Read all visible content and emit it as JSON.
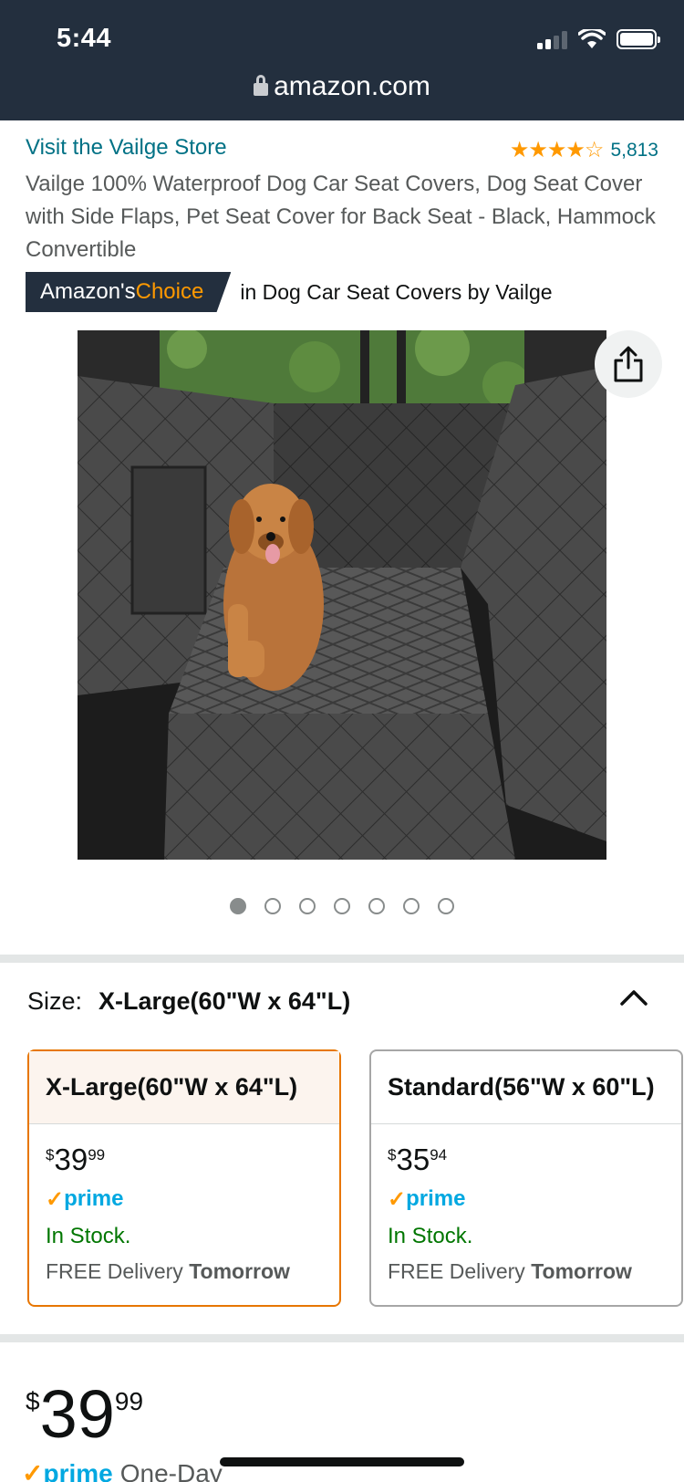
{
  "status_bar": {
    "time": "5:44"
  },
  "url_bar": {
    "domain": "amazon.com"
  },
  "product": {
    "store_link": "Visit the Vailge Store",
    "stars": "★★★★☆",
    "rating_count": "5,813",
    "title": "Vailge 100% Waterproof Dog Car Seat Covers, Dog Seat Cover with Side Flaps, Pet Seat Cover for Back Seat - Black, Hammock Convertible",
    "badge_prefix": "Amazon's",
    "badge_choice": "Choice",
    "badge_category": "in Dog Car Seat Covers by Vailge",
    "image_count": 7,
    "active_image": 1
  },
  "size": {
    "label": "Size:",
    "selected": "X-Large(60\"W x 64\"L)"
  },
  "options": [
    {
      "name": "X-Large(60\"W x 64\"L)",
      "currency": "$",
      "whole": "39",
      "fraction": "99",
      "prime": "prime",
      "stock": "In Stock.",
      "delivery_prefix": "FREE Delivery",
      "delivery_day": "Tomorrow"
    },
    {
      "name": "Standard(56\"W x 60\"L)",
      "currency": "$",
      "whole": "35",
      "fraction": "94",
      "prime": "prime",
      "stock": "In Stock.",
      "delivery_prefix": "FREE Delivery",
      "delivery_day": "Tomorrow"
    }
  ],
  "main_price": {
    "currency": "$",
    "whole": "39",
    "fraction": "99"
  },
  "prime_badge": {
    "check": "✓",
    "word": "prime",
    "suffix": "One-Day"
  },
  "colors": {
    "topbar": "#232f3e",
    "link": "#007185",
    "accent": "#ff9900",
    "stock": "#007600",
    "selected_border": "#e77600"
  }
}
